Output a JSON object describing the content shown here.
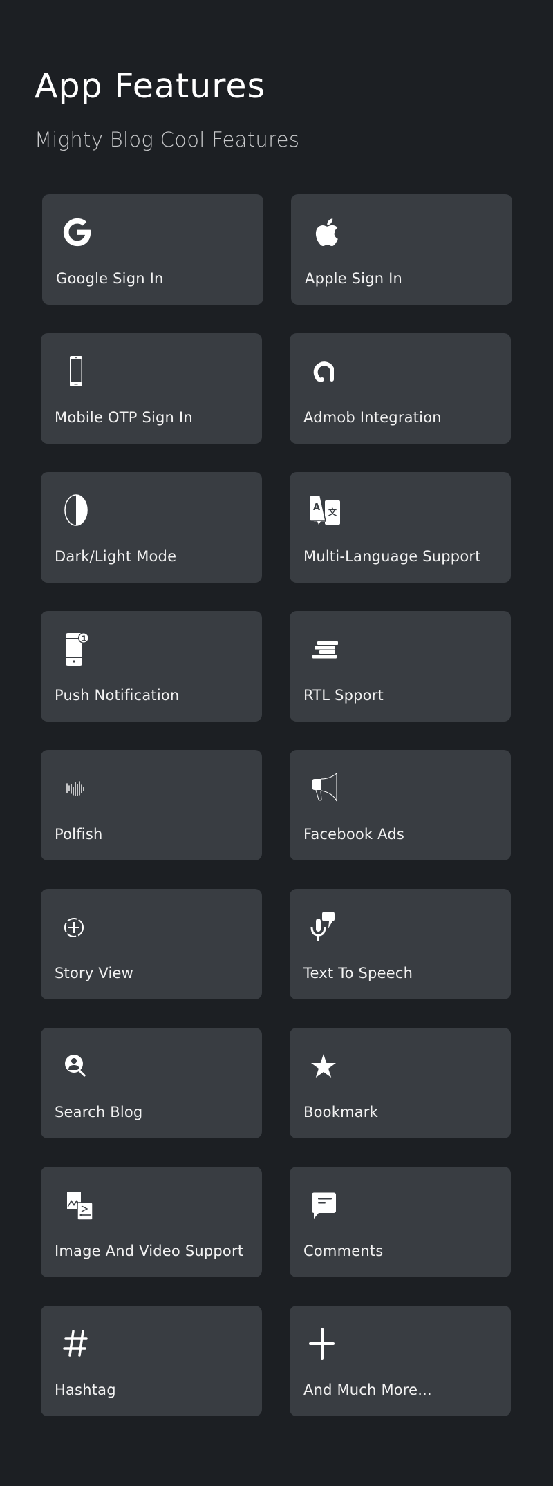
{
  "header": {
    "title": "App Features",
    "subtitle": "Mighty Blog Cool Features"
  },
  "colors": {
    "background": "#1c1f23",
    "card": "#393d42",
    "text": "#ffffff",
    "subtitle": "#c8c9cb"
  },
  "features": [
    {
      "label": "Google Sign In",
      "icon": "google-icon"
    },
    {
      "label": "Apple Sign In",
      "icon": "apple-icon"
    },
    {
      "label": "Mobile OTP Sign In",
      "icon": "mobile-phone-icon"
    },
    {
      "label": "Admob Integration",
      "icon": "admob-icon"
    },
    {
      "label": "Dark/Light Mode",
      "icon": "contrast-icon"
    },
    {
      "label": "Multi-Language Support",
      "icon": "translate-icon"
    },
    {
      "label": "Push Notification",
      "icon": "phone-notification-icon"
    },
    {
      "label": "RTL Spport",
      "icon": "align-right-icon"
    },
    {
      "label": "Polfish",
      "icon": "sound-wave-icon"
    },
    {
      "label": "Facebook Ads",
      "icon": "megaphone-icon"
    },
    {
      "label": "Story View",
      "icon": "add-story-icon"
    },
    {
      "label": "Text To Speech",
      "icon": "microphone-speech-icon"
    },
    {
      "label": "Search Blog",
      "icon": "search-user-icon"
    },
    {
      "label": "Bookmark",
      "icon": "star-icon"
    },
    {
      "label": "Image And Video Support",
      "icon": "image-video-icon"
    },
    {
      "label": "Comments",
      "icon": "comment-icon"
    },
    {
      "label": "Hashtag",
      "icon": "hashtag-icon"
    },
    {
      "label": "And Much More...",
      "icon": "plus-icon"
    }
  ]
}
